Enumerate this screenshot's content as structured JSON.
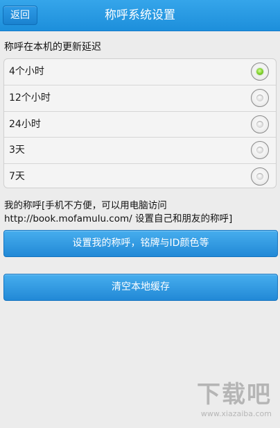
{
  "header": {
    "back_label": "返回",
    "title": "称呼系统设置"
  },
  "section": {
    "label": "称呼在本机的更新延迟"
  },
  "options": [
    {
      "label": "4个小时",
      "checked": true
    },
    {
      "label": "12个小时",
      "checked": false
    },
    {
      "label": "24小时",
      "checked": false
    },
    {
      "label": "3天",
      "checked": false
    },
    {
      "label": "7天",
      "checked": false
    }
  ],
  "info": {
    "text": "我的称呼[手机不方便，可以用电脑访问 http://book.mofamulu.com/ 设置自己和朋友的称呼]"
  },
  "buttons": {
    "set_name": "设置我的称呼，铭牌与ID颜色等",
    "clear_cache": "清空本地缓存"
  },
  "watermark": {
    "main": "下载吧",
    "sub": "www.xiazaiba.com"
  },
  "colors": {
    "header": "#1d8fdb",
    "button": "#2b90db",
    "selected": "#82d22d"
  }
}
